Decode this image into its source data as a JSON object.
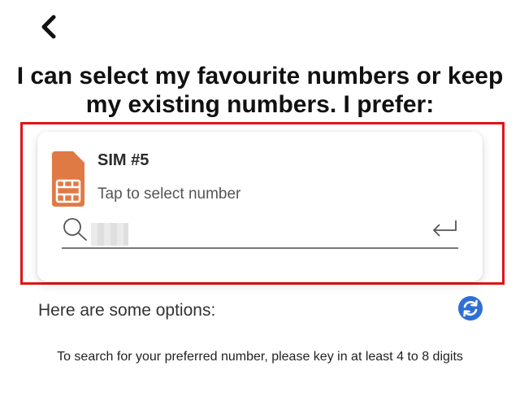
{
  "header": {
    "back_icon": "chevron-left-icon"
  },
  "title": "I can select my favourite numbers or keep my existing numbers. I prefer:",
  "sim_card": {
    "name": "SIM #5",
    "hint": "Tap to select number",
    "icon": "sim-card-icon",
    "icon_color": "#E07A45"
  },
  "search": {
    "icon": "search-icon",
    "value": "",
    "placeholder": "",
    "submit_icon": "enter-return-icon"
  },
  "options": {
    "label": "Here are some options:",
    "refresh_icon": "refresh-icon",
    "refresh_color": "#2F6FD6"
  },
  "instructions": "To search for your preferred number, please key in at least 4 to 8 digits",
  "colors": {
    "highlight_border": "#E11515"
  }
}
